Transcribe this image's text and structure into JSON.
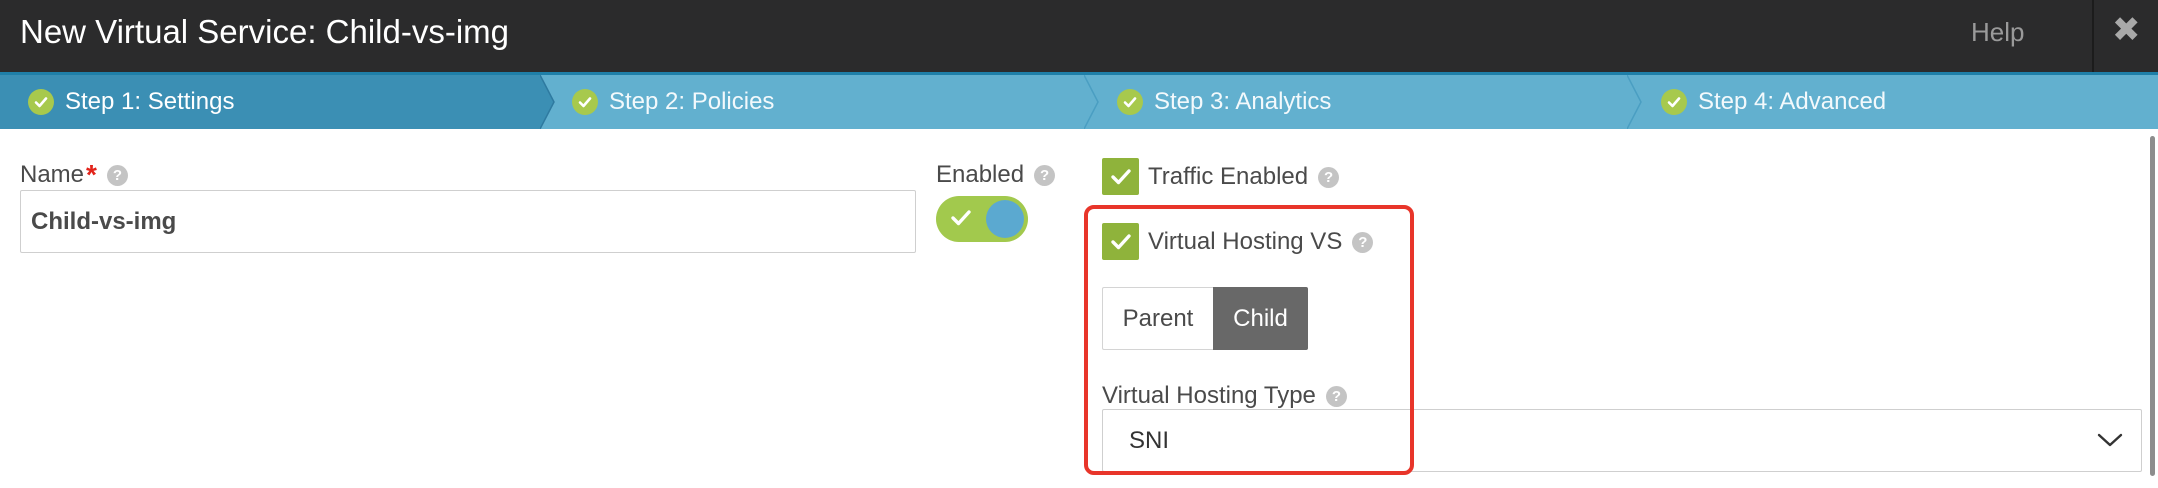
{
  "header": {
    "title": "New Virtual Service: Child-vs-img",
    "help_label": "Help",
    "close_glyph": "✖"
  },
  "steps": [
    {
      "label": "Step 1: Settings",
      "active": true
    },
    {
      "label": "Step 2: Policies",
      "active": false
    },
    {
      "label": "Step 3: Analytics",
      "active": false
    },
    {
      "label": "Step 4: Advanced",
      "active": false
    }
  ],
  "form": {
    "name_label": "Name",
    "name_required_mark": "*",
    "name_value": "Child-vs-img",
    "enabled_label": "Enabled",
    "enabled_on": true,
    "traffic_enabled_label": "Traffic Enabled",
    "traffic_enabled_checked": true,
    "virtual_hosting_label": "Virtual Hosting VS",
    "virtual_hosting_checked": true,
    "role_options": [
      "Parent",
      "Child"
    ],
    "role_selected": "Child",
    "hosting_type_label": "Virtual Hosting Type",
    "hosting_type_value": "SNI"
  },
  "icons": {
    "help": "question-mark-circle-icon",
    "check": "checkmark-icon",
    "dropdown": "chevron-down-icon",
    "close": "close-icon"
  },
  "colors": {
    "header_bg": "#2b2b2c",
    "steps_bg": "#62b0cf",
    "active_step_bg": "#3b8fb4",
    "check_green": "#8fb33b",
    "highlight_red": "#e8352a"
  }
}
